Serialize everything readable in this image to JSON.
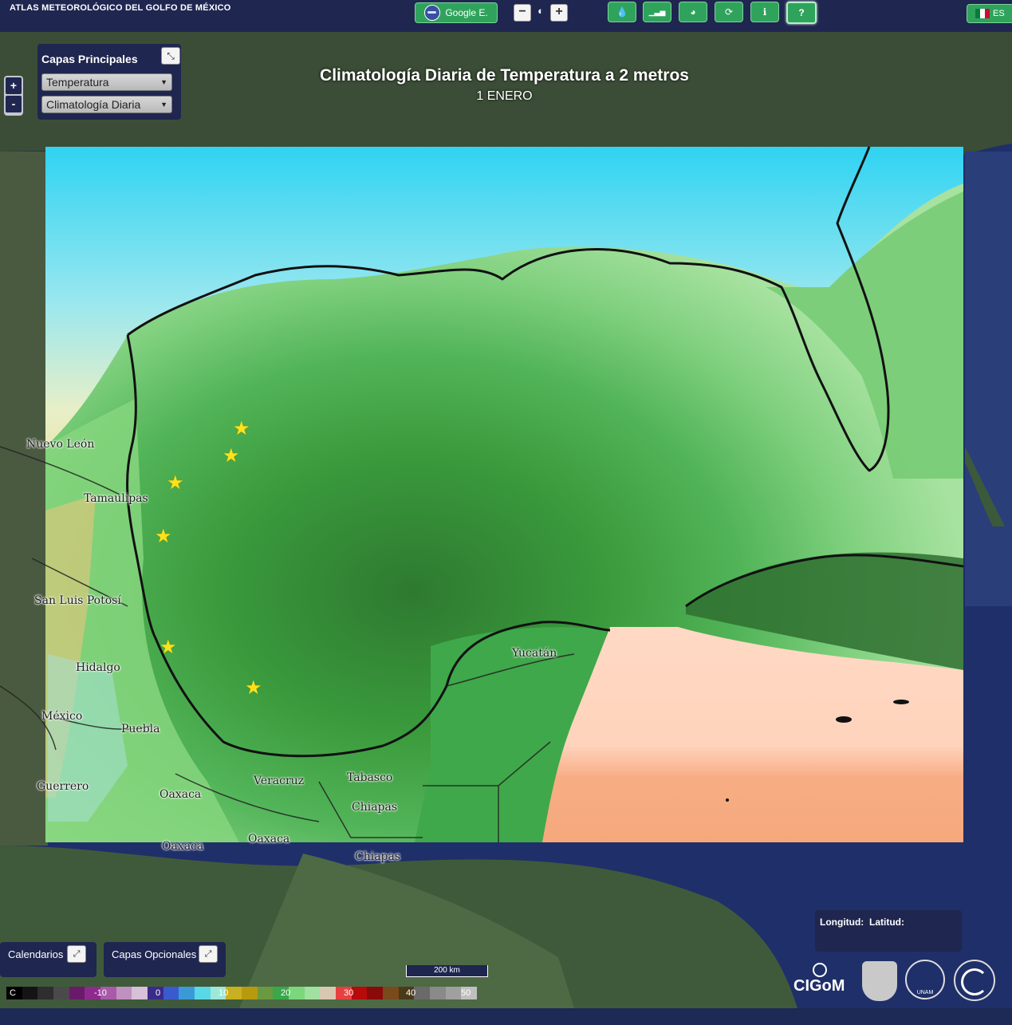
{
  "header": {
    "app_title": "ATLAS METEOROLÓGICO DEL GOLFO DE MÉXICO",
    "base_layer_button": "Google E.",
    "zoom_out": "−",
    "zoom_in": "+",
    "tool_icons": [
      "water-drop-icon",
      "bar-chart-icon",
      "globe-icon",
      "refresh-icon",
      "info-icon",
      "help-icon"
    ],
    "tool_glyphs": [
      "💧",
      "▁▃▅",
      "◕",
      "⟳",
      "ℹ",
      "?"
    ],
    "language": "ES"
  },
  "layers_panel": {
    "title": "Capas Principales",
    "variable_select": "Temperatura",
    "product_select": "Climatología Diaria"
  },
  "map_zoom": {
    "in": "+",
    "out": "-"
  },
  "map": {
    "title": "Climatología Diaria de Temperatura a 2 metros",
    "subtitle": "1 ENERO",
    "place_labels": [
      "Nuevo León",
      "Tamaulipas",
      "San Luis Potosí",
      "Hidalgo",
      "México",
      "Puebla",
      "Guerrero",
      "Oaxaca",
      "Veracruz",
      "Tabasco",
      "Chiapas",
      "Oaxaca",
      "Oaxaca",
      "Chiapas",
      "Yucatán"
    ],
    "station_markers": 6
  },
  "bottom": {
    "calendars_label": "Calendarios",
    "optional_layers_label": "Capas Opcionales",
    "scale_label": "200 km",
    "coords_longitude": "Longitud:",
    "coords_latitude": "Latitud:",
    "logo_text": "CIGoM",
    "unam_text": "UNAM"
  },
  "legend": {
    "unit": "C",
    "labels": [
      "-10",
      "0",
      "10",
      "20",
      "30",
      "40",
      "50"
    ],
    "colors": [
      "#000000",
      "#141414",
      "#2e2e2e",
      "#4a4a4a",
      "#6a1a6a",
      "#8e2a8e",
      "#a85aa8",
      "#c090c0",
      "#d8c0d8",
      "#3a2a8a",
      "#3a5ad0",
      "#3a9ad8",
      "#5ad8e8",
      "#9ee8d8",
      "#c8b020",
      "#b89a10",
      "#6a9a40",
      "#3aa84a",
      "#7ad87a",
      "#a0e0a0",
      "#d8c8b0",
      "#e84040",
      "#b80a0a",
      "#8a0a0a",
      "#7a4a1a",
      "#4a3a1a",
      "#6a6a6a",
      "#8a8a8a",
      "#a0a0a0",
      "#c0c0c0"
    ]
  }
}
